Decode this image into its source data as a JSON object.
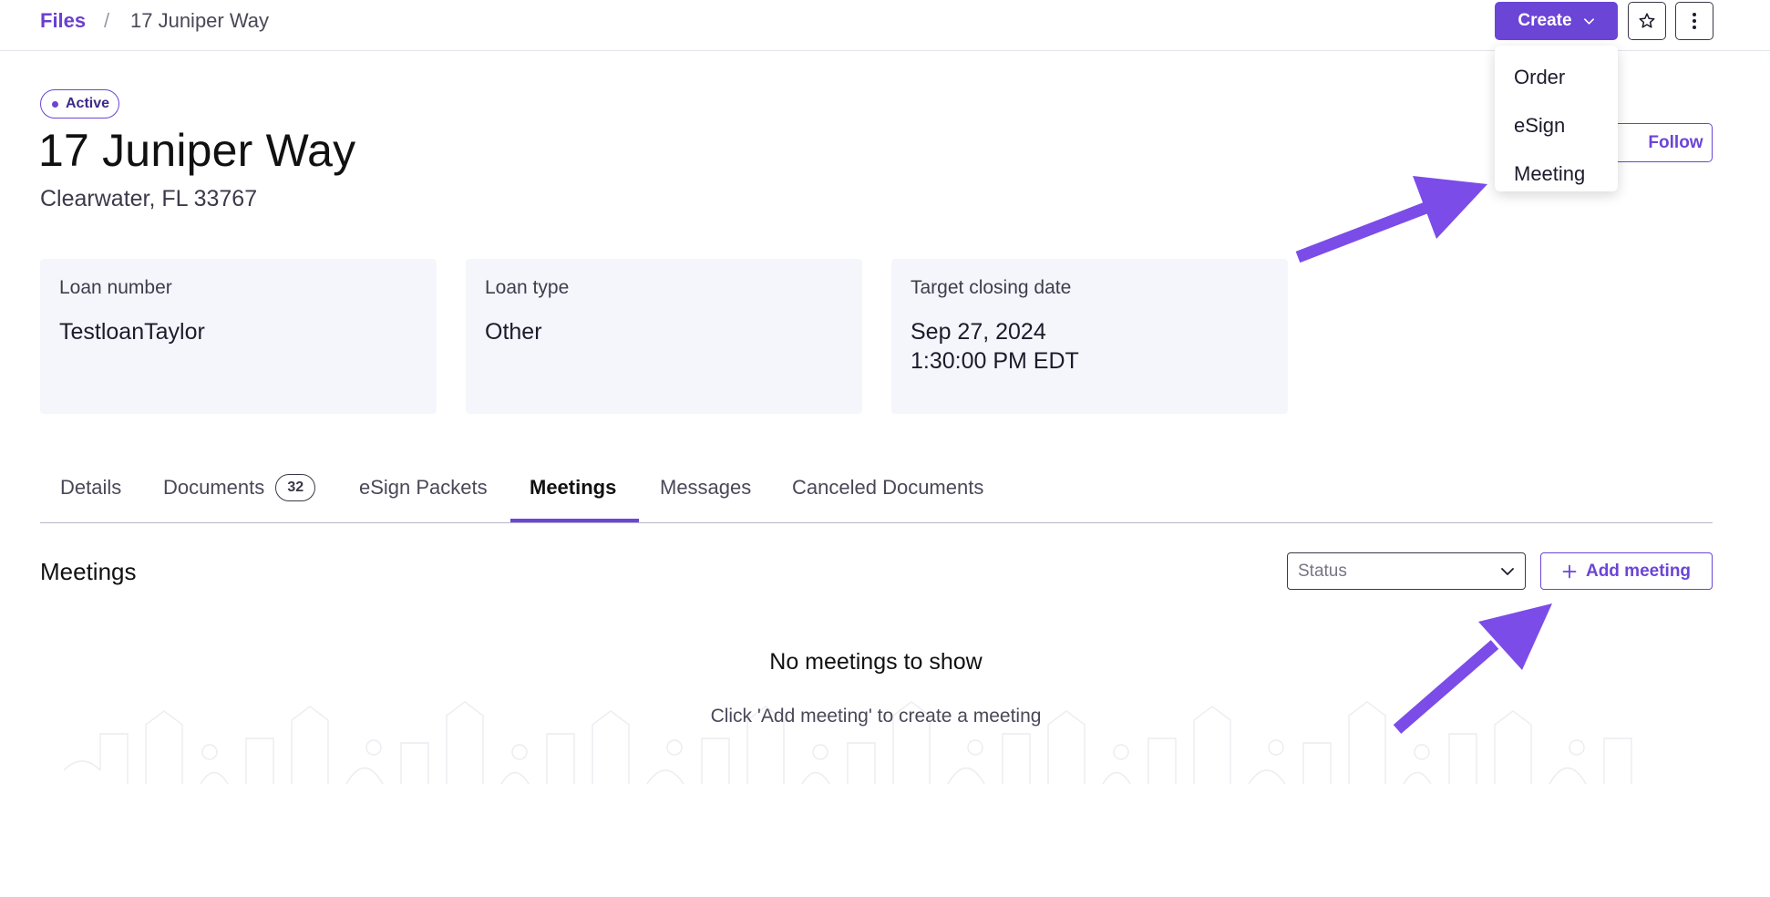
{
  "breadcrumb": {
    "root": "Files",
    "separator": "/",
    "current": "17 Juniper Way"
  },
  "toolbar": {
    "create_label": "Create",
    "create_menu": [
      "Order",
      "eSign",
      "Meeting"
    ],
    "follow_label": "Follow"
  },
  "header": {
    "status": "Active",
    "title": "17 Juniper Way",
    "subtitle": "Clearwater, FL 33767"
  },
  "cards": [
    {
      "label": "Loan number",
      "value": "TestloanTaylor"
    },
    {
      "label": "Loan type",
      "value": "Other"
    },
    {
      "label": "Target closing date",
      "value": "Sep 27, 2024\n1:30:00 PM EDT"
    }
  ],
  "tabs": [
    {
      "label": "Details"
    },
    {
      "label": "Documents",
      "badge": "32"
    },
    {
      "label": "eSign Packets"
    },
    {
      "label": "Meetings",
      "active": true
    },
    {
      "label": "Messages"
    },
    {
      "label": "Canceled Documents"
    }
  ],
  "meetings": {
    "title": "Meetings",
    "status_placeholder": "Status",
    "add_label": "Add meeting",
    "empty_title": "No meetings to show",
    "empty_subtitle": "Click 'Add meeting' to create a meeting"
  },
  "colors": {
    "accent": "#6b45d6",
    "annotation_arrow": "#7b4ce8",
    "card_bg": "#f5f6fb"
  },
  "icons": [
    "chevron-down-icon",
    "star-icon",
    "more-vertical-icon",
    "plus-icon",
    "status-dot-icon"
  ]
}
